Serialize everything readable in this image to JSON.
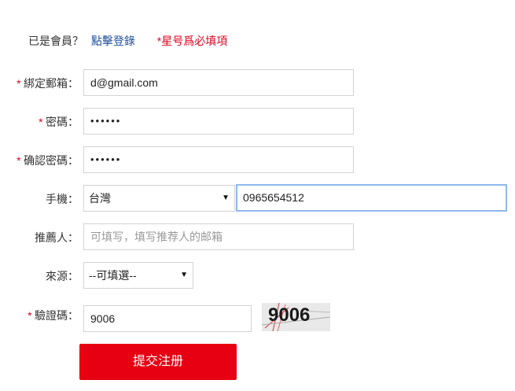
{
  "header": {
    "member_question": "已是會員？",
    "login_link": "點擊登錄",
    "required_note": "*星号爲必填項"
  },
  "form": {
    "email": {
      "label": "綁定郵箱：",
      "value": "d@gmail.com",
      "required": true
    },
    "password": {
      "label": "密碼：",
      "value": "••••••",
      "required": true
    },
    "confirm_password": {
      "label": "确認密碼：",
      "value": "••••••",
      "required": true
    },
    "phone": {
      "label": "手機：",
      "country": "台灣",
      "value": "0965654512",
      "required": false
    },
    "referrer": {
      "label": "推薦人：",
      "placeholder": "可填写，填写推荐人的邮箱",
      "required": false
    },
    "source": {
      "label": "來源：",
      "selected": "--可填選--",
      "required": false
    },
    "captcha": {
      "label": "驗證碼：",
      "value": "9006",
      "image_text": "9006",
      "required": true
    }
  },
  "submit_label": "提交注册",
  "colors": {
    "accent_red": "#e60012",
    "link_blue": "#1d4e9e",
    "focus_border": "#8fb8ee"
  },
  "icons": {
    "dropdown": "caret-down-icon"
  }
}
